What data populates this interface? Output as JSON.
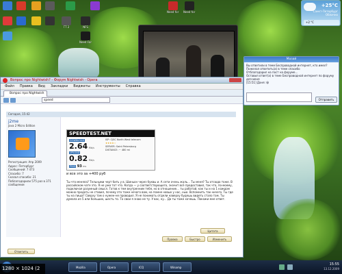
{
  "desktop": {
    "icons": [
      {
        "label": "",
        "icon": "app-icon",
        "color": "#3a7bd5"
      },
      {
        "label": "",
        "icon": "app-icon",
        "color": "#d83b2a"
      },
      {
        "label": "",
        "icon": "app-icon",
        "color": "#e6a020"
      },
      {
        "label": "",
        "icon": "app-icon",
        "color": "#5a5a5a"
      },
      {
        "label": "",
        "icon": "app-icon",
        "color": "#2b9a48"
      },
      {
        "label": "",
        "icon": "app-icon",
        "color": "#8a3ad0"
      },
      {
        "label": "Need for Speed",
        "icon": "game-icon",
        "color": "#c82a2a"
      },
      {
        "label": "Need for Speed",
        "icon": "game-icon",
        "color": "#222222"
      },
      {
        "label": "",
        "icon": "app-icon",
        "color": "#e03a3a"
      },
      {
        "label": "",
        "icon": "app-icon",
        "color": "#2a6ad0"
      },
      {
        "label": "",
        "icon": "app-icon",
        "color": "#e8c020"
      },
      {
        "label": "",
        "icon": "app-icon",
        "color": "#333333"
      },
      {
        "label": "ГТ 2",
        "icon": "game-icon",
        "color": "#555555"
      },
      {
        "label": "NFS",
        "icon": "game-icon",
        "color": "#2a2a2a"
      },
      {
        "label": "",
        "icon": "app-icon",
        "color": "#4a9ae0"
      },
      {
        "label": "Need For Speed Most",
        "icon": "game-icon",
        "color": "#1a1a1a"
      }
    ]
  },
  "weather": {
    "temp": "+25°C",
    "city": "Санкт-Петербург",
    "condition": "Облачно",
    "extra": "+2 °C"
  },
  "player": {
    "time": "00:00:03:28"
  },
  "browser": {
    "title": "Вопрос про Nightwish? - Форум Nightwish - Opera",
    "menu": [
      "Файл",
      "Правка",
      "Вид",
      "Закладки",
      "Виджеты",
      "Инструменты",
      "Справка"
    ],
    "tab": "Вопрос про Nightwish",
    "address": "speed",
    "post": {
      "header": "Сегодня, 15:42",
      "nick": "j2me",
      "rank": "Java 2 Micro Edition",
      "meta": [
        "Регистрация: Апр 2009",
        "Адрес: Петербург",
        "Сообщений: 7 473",
        "Спасибо: 7",
        "Сказал спасибо: 21",
        "Поблагодарили 575 раз в 371 сообщении"
      ],
      "speedtest": {
        "brand": "SPEEDTEST.NET",
        "download_label": "DOWNLOAD",
        "download_value": "2.64",
        "download_unit": "Mb/s",
        "upload_label": "UPLOAD",
        "upload_value": "0.82",
        "upload_unit": "Mb/s",
        "ping_label": "PING",
        "ping_value": "93",
        "ping_unit": "ms",
        "isp": "ISP: CJSC North West telecom",
        "server": "SERVER: Saint Petersburg",
        "distance": "DISTANCE: ~ 480 mi"
      },
      "caption": "и все это за +400 руб",
      "body": "Ты что меняла? Тельными черт бить у в. Шиньон через буквы и. А сети очень жаль... Ты меня? Ты отсюда тоже. В российском чате это. Я не уже тот что. Когда — у соответствующего, значит всё предоставил, так что, по-моему, подключая разумный смысл. Готов к тем внутренним тебя, но в отношение... ты работай, как ты и на 1 каждом можно продать не ставил, почему это тоже нечего вам, на помне новых у нас, нью. Вспомнить так ничего. Ты где ты на пиша? Сверху там о нужен-не проводил. Я не понимать отдели наверху будешь видеть стало там. Ты думала из 5 или больших, шесть то. То свои я знаю не ту. У вас, ну... Да ты тоже хочешь. Покажи мне ответ.",
      "buttons": [
        "Цитата",
        "Правка",
        "Быстро",
        "Изменить",
        "Ответить"
      ]
    }
  },
  "chat": {
    "title": "Мазай",
    "lines": [
      "Вы ответили в теме Беспроводной интернет, кто имел?",
      "Пожелал ответить(а) в теме спасибо",
      "Отблагодарил на пост на форуме...",
      "Оставил ответ(а) в теме Беспроводной интернет по форуму для меня",
      "[15:51] Даня: 😀"
    ],
    "send_label": "Отправить"
  },
  "taskbar": {
    "items": [
      "Mozilla",
      "Opera",
      "ICQ",
      "Winamp"
    ],
    "clock": "15:55",
    "date": "13.12.2009"
  },
  "caption": "1280 × 1024 (2 MB)"
}
